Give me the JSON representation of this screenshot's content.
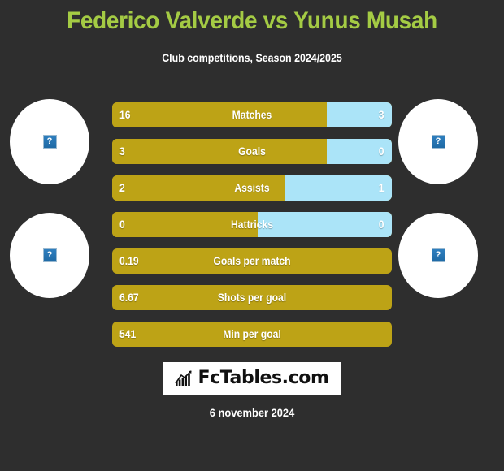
{
  "header": {
    "title": "Federico Valverde vs Yunus Musah",
    "subtitle": "Club competitions, Season 2024/2025",
    "title_color": "#a4cb44",
    "subtitle_color": "#ffffff"
  },
  "colors": {
    "background": "#2e2e2e",
    "home_bar": "#bda316",
    "away_bar": "#abe4f8",
    "accent_green": "#a4cb44",
    "logo_background": "#ffffff"
  },
  "players": {
    "home": {
      "name": "Federico Valverde",
      "photo_alt": "?"
    },
    "away": {
      "name": "Yunus Musah",
      "photo_alt": "?"
    }
  },
  "avatars": [
    {
      "side": "left",
      "position": "top",
      "placeholder": "?"
    },
    {
      "side": "left",
      "position": "bottom",
      "placeholder": "?"
    },
    {
      "side": "right",
      "position": "top",
      "placeholder": "?"
    },
    {
      "side": "right",
      "position": "bottom",
      "placeholder": "?"
    }
  ],
  "chart_data": {
    "type": "bar",
    "title": "Federico Valverde vs Yunus Musah",
    "subtitle": "Club competitions, Season 2024/2025",
    "orientation": "horizontal-diverging",
    "series": [
      {
        "name": "Federico Valverde",
        "color": "#bda316"
      },
      {
        "name": "Yunus Musah",
        "color": "#abe4f8"
      }
    ],
    "categories": [
      "Matches",
      "Goals",
      "Assists",
      "Hattricks",
      "Goals per match",
      "Shots per goal",
      "Min per goal"
    ],
    "rows": [
      {
        "label": "Matches",
        "home": "16",
        "away": "3",
        "home_pct": 76.7,
        "split": true
      },
      {
        "label": "Goals",
        "home": "3",
        "away": "0",
        "home_pct": 76.7,
        "split": true
      },
      {
        "label": "Assists",
        "home": "2",
        "away": "1",
        "home_pct": 61.6,
        "split": true
      },
      {
        "label": "Hattricks",
        "home": "0",
        "away": "0",
        "home_pct": 52.0,
        "split": true
      },
      {
        "label": "Goals per match",
        "home": "0.19",
        "away": "",
        "home_pct": 100,
        "split": false
      },
      {
        "label": "Shots per goal",
        "home": "6.67",
        "away": "",
        "home_pct": 100,
        "split": false
      },
      {
        "label": "Min per goal",
        "home": "541",
        "away": "",
        "home_pct": 100,
        "split": false
      }
    ]
  },
  "logo": {
    "text": "FcTables.com",
    "icon": "bar-chart-growth-icon"
  },
  "footer": {
    "date": "6 november 2024"
  }
}
